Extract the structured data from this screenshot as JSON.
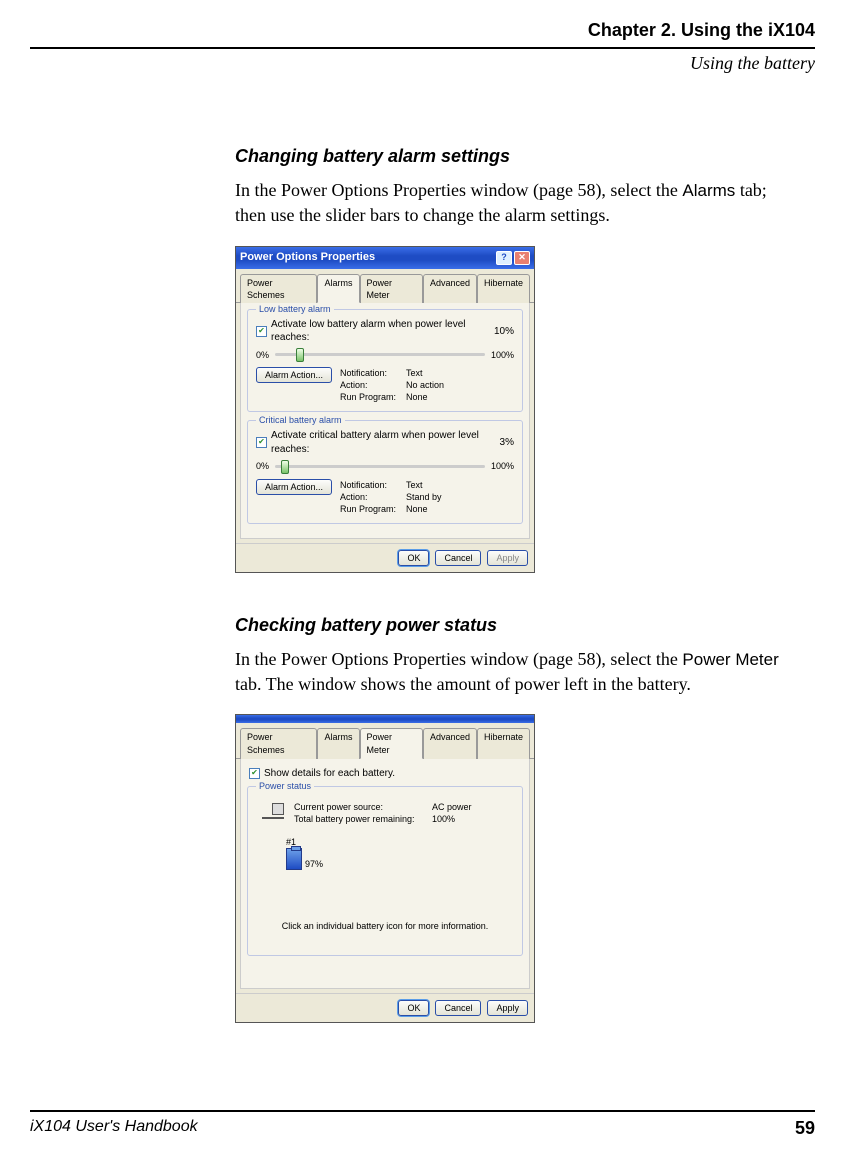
{
  "header": {
    "chapter": "Chapter 2. Using the iX104",
    "section": "Using the battery"
  },
  "section1": {
    "heading": "Changing battery alarm settings",
    "para_pre": "In the Power Options Properties window (page 58), select the ",
    "para_bold": "Alarms",
    "para_post": " tab; then use the slider bars to change the alarm settings."
  },
  "section2": {
    "heading": "Checking battery power status",
    "para_pre": "In the Power Options Properties window (page 58), select the ",
    "para_bold": "Power Meter",
    "para_post": " tab. The window shows the amount of power left in the battery."
  },
  "dialog": {
    "title": "Power Options Properties",
    "tabs": [
      "Power Schemes",
      "Alarms",
      "Power Meter",
      "Advanced",
      "Hibernate"
    ],
    "buttons": {
      "ok": "OK",
      "cancel": "Cancel",
      "apply": "Apply"
    },
    "alarm_action_label": "Alarm Action...",
    "labels": {
      "notification": "Notification:",
      "action": "Action:",
      "run_program": "Run Program:"
    }
  },
  "alarms_tab": {
    "group1": {
      "legend": "Low battery alarm",
      "checkbox_label": "Activate low battery alarm when power level reaches:",
      "value": "10%",
      "slider_min": "0%",
      "slider_max": "100%",
      "notification": "Text",
      "action": "No action",
      "run_program": "None"
    },
    "group2": {
      "legend": "Critical battery alarm",
      "checkbox_label": "Activate critical battery alarm when power level reaches:",
      "value": "3%",
      "slider_min": "0%",
      "slider_max": "100%",
      "notification": "Text",
      "action": "Stand by",
      "run_program": "None"
    }
  },
  "power_meter_tab": {
    "show_details_label": "Show details for each battery.",
    "group_legend": "Power status",
    "source_label": "Current power source:",
    "source_value": "AC power",
    "remaining_label": "Total battery power remaining:",
    "remaining_value": "100%",
    "battery_id": "#1",
    "battery_percent": "97%",
    "help_text": "Click an individual battery icon for more information."
  },
  "footer": {
    "doc_title": "iX104 User's Handbook",
    "page": "59"
  }
}
